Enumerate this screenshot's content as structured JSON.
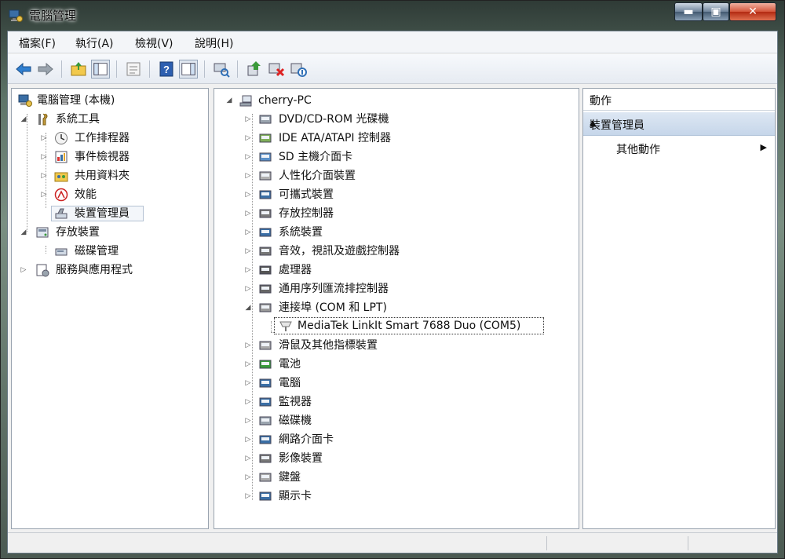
{
  "window": {
    "title": "電腦管理",
    "controls": {
      "min": "▬",
      "max": "▣",
      "close": "✕"
    }
  },
  "menu": [
    "檔案(F)",
    "執行(A)",
    "檢視(V)",
    "說明(H)"
  ],
  "toolbar": [
    "back-icon",
    "forward-icon",
    "up-folder-icon",
    "show-hide-tree-icon",
    "export-list-icon",
    "help-icon",
    "show-action-pane-icon",
    "scan-hardware-icon",
    "update-driver-icon",
    "uninstall-icon",
    "disable-device-icon"
  ],
  "left_tree": [
    {
      "label": "電腦管理 (本機)",
      "level": 0,
      "twisty": "",
      "icon": "computer-management-icon"
    },
    {
      "label": "系統工具",
      "level": 1,
      "twisty": "◢",
      "icon": "system-tools-icon"
    },
    {
      "label": "工作排程器",
      "level": 2,
      "twisty": "▷",
      "icon": "task-scheduler-icon"
    },
    {
      "label": "事件檢視器",
      "level": 2,
      "twisty": "▷",
      "icon": "event-viewer-icon"
    },
    {
      "label": "共用資料夾",
      "level": 2,
      "twisty": "▷",
      "icon": "shared-folders-icon"
    },
    {
      "label": "效能",
      "level": 2,
      "twisty": "▷",
      "icon": "performance-icon"
    },
    {
      "label": "裝置管理員",
      "level": 2,
      "twisty": "",
      "icon": "device-manager-icon",
      "selected": true
    },
    {
      "label": "存放裝置",
      "level": 1,
      "twisty": "◢",
      "icon": "storage-icon"
    },
    {
      "label": "磁碟管理",
      "level": 2,
      "twisty": "",
      "icon": "disk-management-icon"
    },
    {
      "label": "服務與應用程式",
      "level": 1,
      "twisty": "▷",
      "icon": "services-applications-icon"
    }
  ],
  "device_tree": {
    "root": "cherry-PC",
    "categories": [
      {
        "label": "DVD/CD-ROM 光碟機",
        "icon": "dvd-drive-icon"
      },
      {
        "label": "IDE ATA/ATAPI 控制器",
        "icon": "ide-controller-icon"
      },
      {
        "label": "SD 主機介面卡",
        "icon": "sd-host-icon"
      },
      {
        "label": "人性化介面裝置",
        "icon": "hid-icon"
      },
      {
        "label": "可攜式裝置",
        "icon": "portable-device-icon"
      },
      {
        "label": "存放控制器",
        "icon": "storage-controller-icon"
      },
      {
        "label": "系統裝置",
        "icon": "system-device-icon"
      },
      {
        "label": "音效，視訊及遊戲控制器",
        "icon": "sound-icon"
      },
      {
        "label": "處理器",
        "icon": "processor-icon"
      },
      {
        "label": "通用序列匯流排控制器",
        "icon": "usb-controller-icon"
      },
      {
        "label": "連接埠 (COM 和 LPT)",
        "icon": "port-icon",
        "expanded": true
      },
      {
        "label": "滑鼠及其他指標裝置",
        "icon": "mouse-icon"
      },
      {
        "label": "電池",
        "icon": "battery-icon"
      },
      {
        "label": "電腦",
        "icon": "computer-icon"
      },
      {
        "label": "監視器",
        "icon": "monitor-icon"
      },
      {
        "label": "磁碟機",
        "icon": "disk-drive-icon"
      },
      {
        "label": "網路介面卡",
        "icon": "network-adapter-icon"
      },
      {
        "label": "影像裝置",
        "icon": "imaging-device-icon"
      },
      {
        "label": "鍵盤",
        "icon": "keyboard-icon"
      },
      {
        "label": "顯示卡",
        "icon": "display-adapter-icon"
      }
    ],
    "port_child": "MediaTek LinkIt Smart 7688 Duo (COM5)"
  },
  "actions": {
    "header": "動作",
    "section": "裝置管理員",
    "more": "其他動作"
  }
}
